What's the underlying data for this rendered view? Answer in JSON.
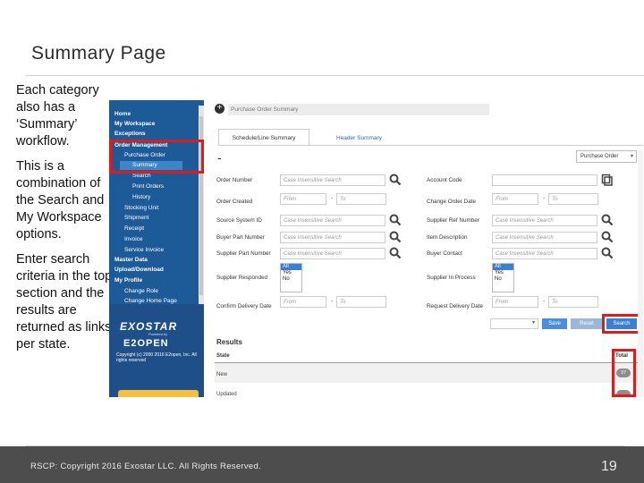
{
  "slide": {
    "title": "Summary Page",
    "bullets": [
      "Each category also has a ‘Summary’ workflow.",
      "This is a combination of the Search and My Workspace options.",
      "Enter search criteria in the top section and the results are returned as links per state."
    ],
    "footer": "RSCP: Copyright 2016 Exostar LLC. All Rights Reserved.",
    "page_number": "19"
  },
  "nav": {
    "items": [
      {
        "label": "Home",
        "style": "bold"
      },
      {
        "label": "My Workspace",
        "style": "bold"
      },
      {
        "label": "Exceptions",
        "style": "bold"
      },
      {
        "label": "Order Management",
        "style": "bold"
      },
      {
        "label": "Purchase Order",
        "style": "sub"
      },
      {
        "label": "Summary",
        "style": "sub2"
      },
      {
        "label": "Search",
        "style": "sub2"
      },
      {
        "label": "Print Orders",
        "style": "sub2"
      },
      {
        "label": "History",
        "style": "sub2"
      },
      {
        "label": "Stocking Unit",
        "style": "sub"
      },
      {
        "label": "Shipment",
        "style": "sub"
      },
      {
        "label": "Receipt",
        "style": "sub"
      },
      {
        "label": "Invoice",
        "style": "sub"
      },
      {
        "label": "Service Invoice",
        "style": "sub"
      },
      {
        "label": "Master Data",
        "style": "bold"
      },
      {
        "label": "Upload/Download",
        "style": "bold"
      },
      {
        "label": "My Profile",
        "style": "bold"
      },
      {
        "label": "Change Role",
        "style": "sub"
      },
      {
        "label": "Change Home Page",
        "style": "sub"
      }
    ],
    "brand": "EXOSTAR",
    "brand_powered": "Powered by",
    "brand2": "E2OPEN",
    "copyright": "Copyright (c) 2000 2016 E2open, Inc. All rights reserved"
  },
  "app": {
    "header": "Purchase Order Summary",
    "tabs": [
      "Schedule/Line Summary",
      "Header Summary"
    ],
    "dash": "-",
    "view_select": "Purchase Order",
    "left_fields": {
      "order_number": "Order Number",
      "order_created": "Order Created",
      "source_system_id": "Source System ID",
      "buyer_part_number": "Buyer Part Number",
      "supplier_part_number": "Supplier Part Number",
      "supplier_responded": "Supplier Responded",
      "confirm_delivery_date": "Confirm Delivery Date"
    },
    "right_fields": {
      "account_code": "Account Code",
      "change_order_date": "Change Order Date",
      "supplier_ref_number": "Supplier Ref Number",
      "item_description": "Item Description",
      "buyer_contact": "Buyer Contact",
      "supplier_in_process": "Supplier In Process",
      "request_delivery_date": "Request Delivery Date"
    },
    "placeholders": {
      "case_insensitive": "Case Insensitive Search",
      "from": "From",
      "to": "To",
      "range_sep": "-"
    },
    "list_options": [
      "All",
      "Yes",
      "No"
    ],
    "buttons": {
      "save": "Save",
      "reset": "Reset",
      "search": "Search"
    },
    "results": {
      "title": "Results",
      "col_state": "State",
      "col_total": "Total",
      "rows": [
        {
          "state": "New",
          "total": "37"
        },
        {
          "state": "Updated",
          "total": ""
        }
      ]
    }
  },
  "colors": {
    "nav_bg": "#1e4f88",
    "highlight": "#e01b1b",
    "accent": "#3b7fd2",
    "footer_bg": "#4d4d4d"
  }
}
